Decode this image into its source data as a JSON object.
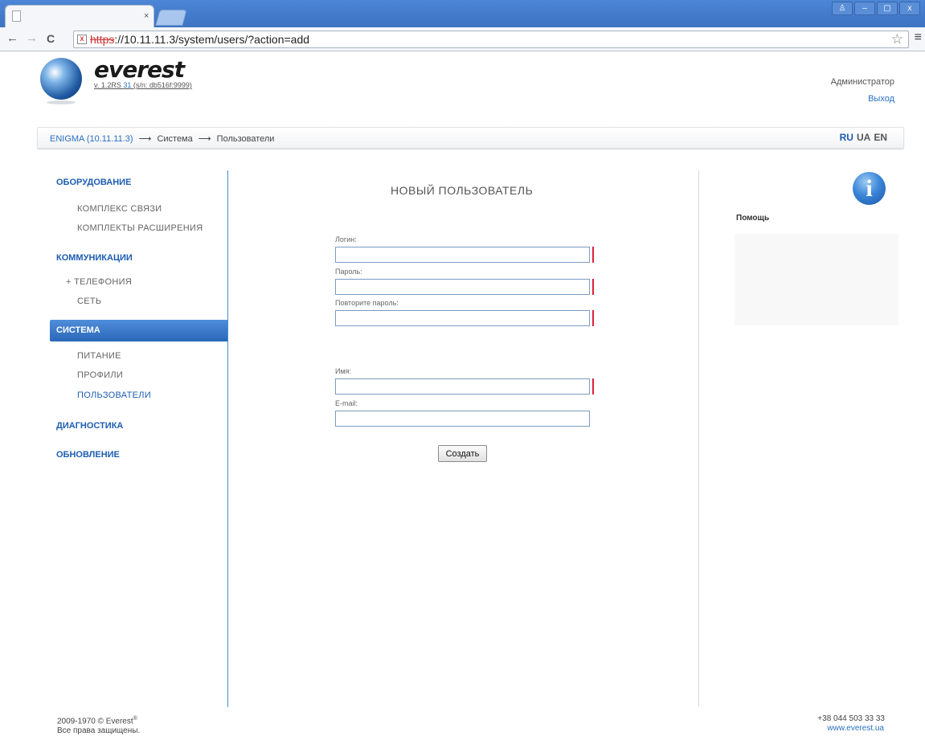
{
  "browser": {
    "tab_close_glyph": "×",
    "window_buttons": [
      "♙",
      "–",
      "▢",
      "x"
    ],
    "nav": {
      "back": "←",
      "forward": "→",
      "reload": "C"
    },
    "url_scheme": "https",
    "url_rest": "://10.11.11.3/system/users/?action=add",
    "lock_glyph": "x",
    "star_glyph": "☆",
    "menu_glyph": "≡"
  },
  "header": {
    "brand": "everest",
    "version_prefix": "v. 1.2RS ",
    "version_build": "31",
    "version_suffix": " (s/n: db516f:9999)",
    "user_role": "Администратор",
    "logout": "Выход"
  },
  "breadcrumb": {
    "root": "ENIGMA (10.11.11.3)",
    "sep": "⟶",
    "items": [
      "Система",
      "Пользователи"
    ]
  },
  "languages": {
    "items": [
      "RU",
      "UA",
      "EN"
    ],
    "active": "RU"
  },
  "sidebar": {
    "equipment": "ОБОРУДОВАНИЕ",
    "equipment_items": [
      "КОМПЛЕКС СВЯЗИ",
      "КОМПЛЕКТЫ РАСШИРЕНИЯ"
    ],
    "communications": "КОММУНИКАЦИИ",
    "telephony": "+  ТЕЛЕФОНИЯ",
    "network": "СЕТЬ",
    "system": "СИСТЕМА",
    "system_items": [
      "ПИТАНИЕ",
      "ПРОФИЛИ",
      "ПОЛЬЗОВАТЕЛИ"
    ],
    "diagnostics": "ДИАГНОСТИКА",
    "update": "ОБНОВЛЕНИЕ"
  },
  "form": {
    "title": "НОВЫЙ ПОЛЬЗОВАТЕЛЬ",
    "login_label": "Логин:",
    "login_value": "",
    "password_label": "Пароль:",
    "password_value": "",
    "repeat_label": "Повторите пароль:",
    "repeat_value": "",
    "name_label": "Имя:",
    "name_value": "",
    "email_label": "E-mail:",
    "email_value": "",
    "submit": "Создать"
  },
  "help": {
    "icon_glyph": "i",
    "title": "Помощь"
  },
  "footer": {
    "copyright": "2009-1970 © Everest",
    "reg_mark": "®",
    "rights": "Все права защищены.",
    "phone": "+38 044 503 33 33",
    "site": "www.everest.ua"
  },
  "colors": {
    "accent": "#1d5db0",
    "active_section": "#2b67b8",
    "required_marker": "#e0203a",
    "browser_frame": "#4d86d6"
  }
}
